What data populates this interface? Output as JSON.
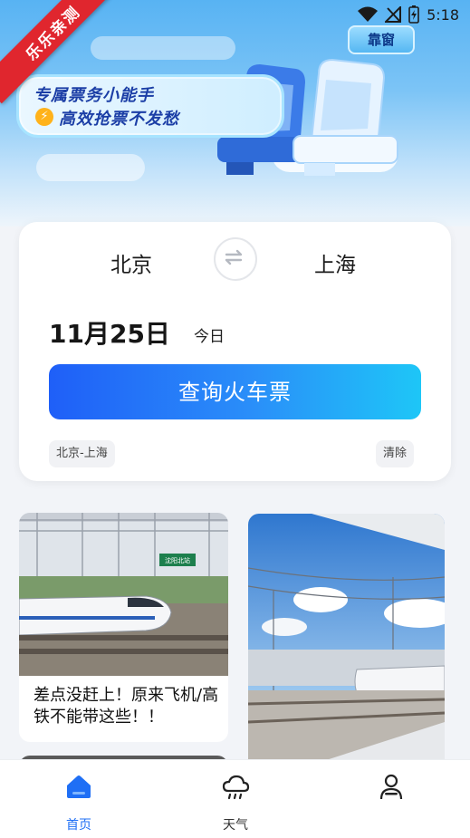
{
  "status_bar": {
    "time": "5:18"
  },
  "banner": {
    "ribbon_text": "乐乐亲测",
    "headline": "专属票务小能手",
    "subline": "高效抢票不发愁",
    "seat_tag": "靠窗"
  },
  "search": {
    "from_city": "北京",
    "to_city": "上海",
    "date": "11月25日",
    "date_hint": "今日",
    "query_label": "查询火车票",
    "history_chip": "北京-上海",
    "clear_label": "清除"
  },
  "feed": [
    {
      "caption": "差点没赶上！原来飞机/高铁不能带这些！！",
      "station_sign": "沈阳北站"
    },
    {
      "caption": ""
    }
  ],
  "nav": {
    "items": [
      {
        "label": "首页",
        "icon": "home-icon",
        "active": true
      },
      {
        "label": "天气",
        "icon": "weather-cloud-icon",
        "active": false
      },
      {
        "label": "",
        "icon": "profile-icon",
        "active": false
      }
    ]
  },
  "colors": {
    "accent": "#1f6ff5",
    "ribbon": "#e0262e"
  }
}
